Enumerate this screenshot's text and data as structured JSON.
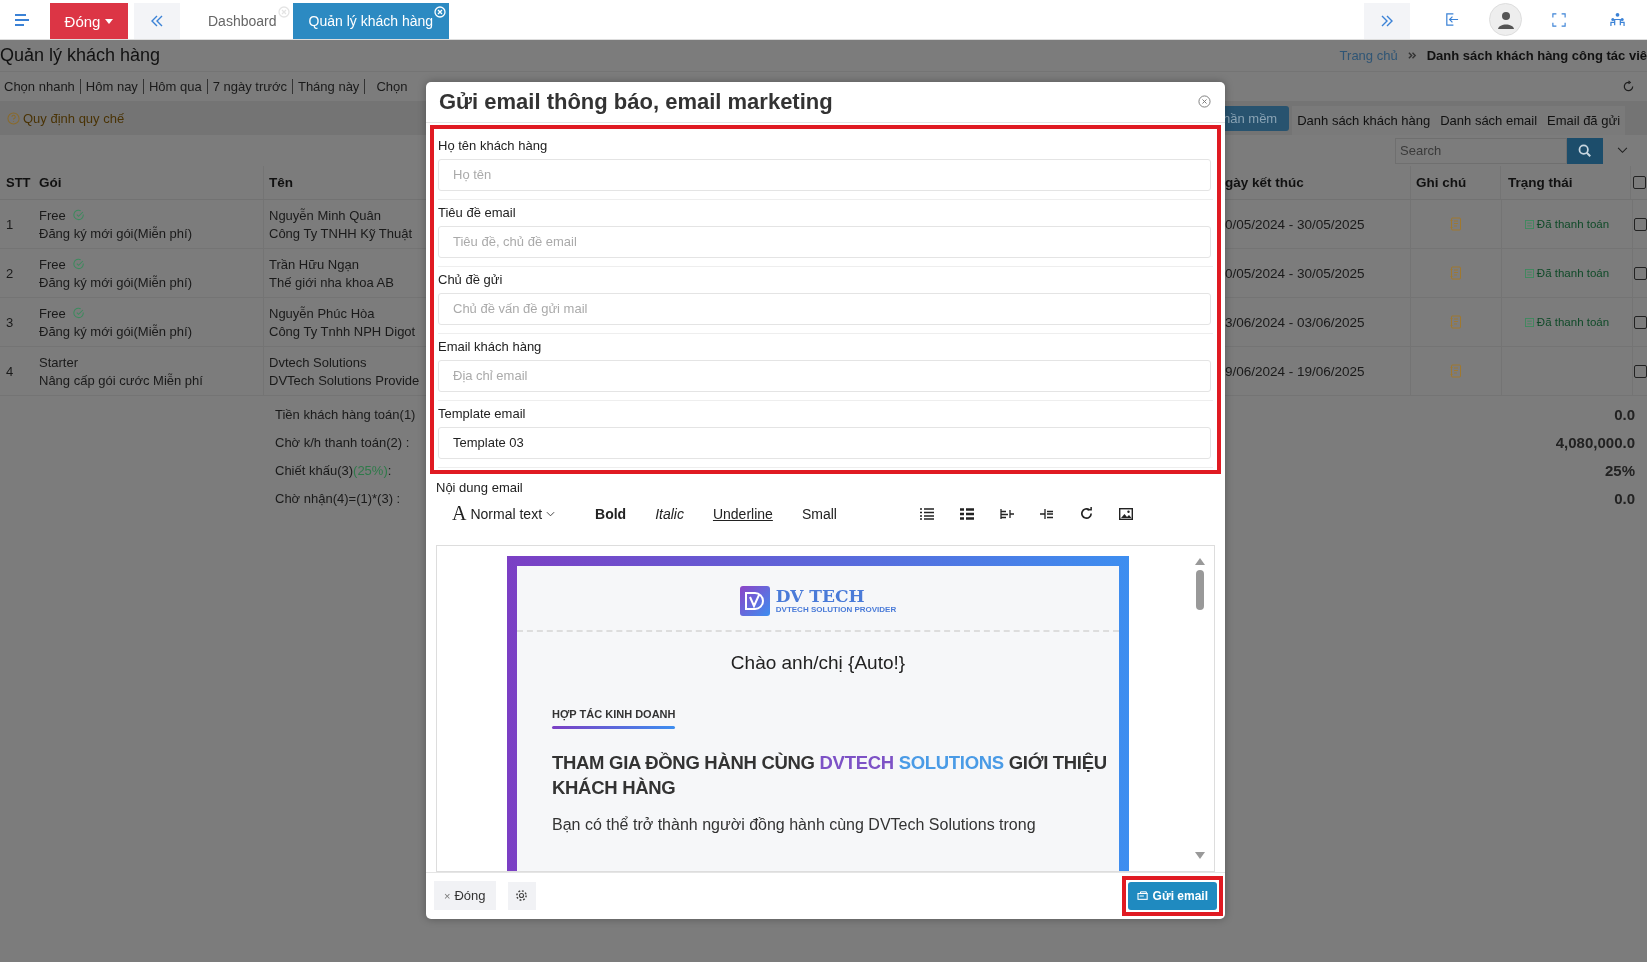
{
  "topbar": {
    "close_button": "Đóng",
    "tabs": [
      {
        "label": "Dashboard",
        "selected": false
      },
      {
        "label": "Quản lý khách hàng",
        "selected": true
      }
    ]
  },
  "page": {
    "title": "Quản lý khách hàng",
    "breadcrumb": [
      "Trang chủ",
      "Danh sách khách hàng công tác viê"
    ],
    "quick_filters": [
      "Chọn nhanh",
      "Hôm nay",
      "Hôm qua",
      "7 ngày trước",
      "Tháng này"
    ],
    "filter_cut": "Chọn",
    "rules_link": "Quy định quy chế",
    "view_tabs": [
      {
        "label": "hần mềm",
        "selected": true
      },
      {
        "label": "Danh sách khách hàng",
        "selected": false
      },
      {
        "label": "Danh sách email",
        "selected": false
      },
      {
        "label": "Email đã gửi",
        "selected": false
      }
    ],
    "search": {
      "placeholder": "Search"
    }
  },
  "table": {
    "columns_left": [
      "STT",
      "Gói",
      "Tên"
    ],
    "columns_right": [
      "gày kết thúc",
      "Ghi chú",
      "Trạng thái"
    ],
    "header_checked": false,
    "rows": [
      {
        "stt": "1",
        "package": "Free",
        "verified": true,
        "package_note": "Đăng ký mới gói(Miễn phí)",
        "name": "Nguyễn Minh Quân",
        "company": "Công Ty TNHH Kỹ Thuật",
        "dates": "0/05/2024 - 30/05/2025",
        "status": "Đã thanh toán",
        "checked": false
      },
      {
        "stt": "2",
        "package": "Free",
        "verified": true,
        "package_note": "Đăng ký mới gói(Miễn phí)",
        "name": "Trần Hữu Ngạn",
        "company": "Thế giới nha khoa AB",
        "dates": "0/05/2024 - 30/05/2025",
        "status": "Đã thanh toán",
        "checked": false
      },
      {
        "stt": "3",
        "package": "Free",
        "verified": true,
        "package_note": "Đăng ký mới gói(Miễn phí)",
        "name": "Nguyễn Phúc Hòa",
        "company": "Công Ty Tnhh NPH Digot",
        "dates": "3/06/2024 - 03/06/2025",
        "status": "Đã thanh toán",
        "checked": false
      },
      {
        "stt": "4",
        "package": "Starter",
        "verified": false,
        "package_note": "Nâng cấp gói cước Miễn phí",
        "name": "Dvtech Solutions",
        "company": "DVTech Solutions Provide",
        "dates": "9/06/2024 - 19/06/2025",
        "checked": false
      }
    ],
    "summary": [
      {
        "label": "Tiền khách hàng toán(1)",
        "value": "0.0"
      },
      {
        "label": "Chờ k/h thanh toán(2) :",
        "value": "4,080,000.0"
      },
      {
        "label": "Chiết khấu(3)",
        "rate": "(25%)",
        "suffix": ":",
        "value": "25%"
      },
      {
        "label": "Chờ nhận(4)=(1)*(3) :",
        "value": "0.0"
      }
    ]
  },
  "modal": {
    "title": "Gửi email thông báo, email marketing",
    "fields": [
      {
        "label": "Họ tên khách hàng",
        "placeholder": "Họ tên"
      },
      {
        "label": "Tiêu đề email",
        "placeholder": "Tiêu đề, chủ đề email"
      },
      {
        "label": "Chủ đề gửi",
        "placeholder": "Chủ đề vấn đề gửi mail"
      },
      {
        "label": "Email khách hàng",
        "placeholder": "Địa chỉ email"
      },
      {
        "label": "Template email",
        "value": "Template 03"
      }
    ],
    "content_label": "Nội dung email",
    "toolbar": {
      "format_glyph": "A",
      "format": "Normal text",
      "styles": [
        {
          "label": "Bold",
          "kind": "bold"
        },
        {
          "label": "Italic",
          "kind": "italic"
        },
        {
          "label": "Underline",
          "kind": "underline"
        },
        {
          "label": "Small",
          "kind": "small"
        }
      ]
    },
    "preview": {
      "logo_name": "DV TECH",
      "logo_tagline": "DVTECH SOLUTION PROVIDER",
      "greeting": "Chào anh/chị {Auto!}",
      "section_tag": "HỢP TÁC KINH DOANH",
      "heading": {
        "before": "THAM GIA ĐỒNG HÀNH CÙNG ",
        "brand_1": "DVTECH",
        "brand_2": " SOLUTIONS",
        "after": " GIỚI THIỆU KHÁCH HÀNG"
      },
      "paragraph": "Bạn có thể trở thành người đồng hành cùng DVTech Solutions trong"
    },
    "footer": {
      "close_glyph": "×",
      "close_button": "Đóng",
      "send_button": "Gửi email"
    }
  }
}
